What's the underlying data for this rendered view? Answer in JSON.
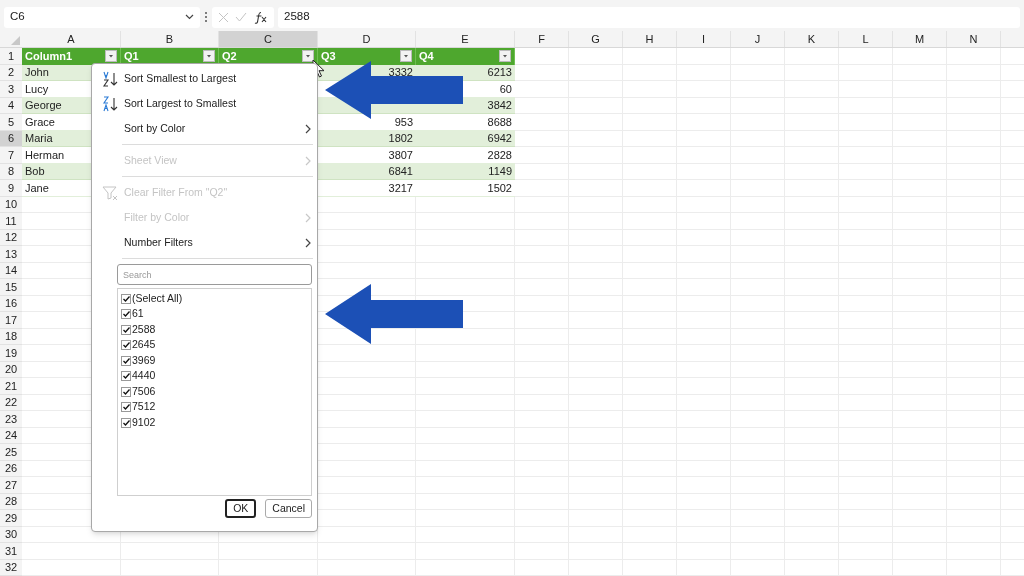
{
  "formula_bar": {
    "name_box": "C6",
    "value": "2588"
  },
  "columns": [
    {
      "label": "A",
      "selected": false
    },
    {
      "label": "B",
      "selected": false
    },
    {
      "label": "C",
      "selected": true
    },
    {
      "label": "D",
      "selected": false
    },
    {
      "label": "E",
      "selected": false
    },
    {
      "label": "F",
      "selected": false
    },
    {
      "label": "G",
      "selected": false
    },
    {
      "label": "H",
      "selected": false
    },
    {
      "label": "I",
      "selected": false
    },
    {
      "label": "J",
      "selected": false
    },
    {
      "label": "K",
      "selected": false
    },
    {
      "label": "L",
      "selected": false
    },
    {
      "label": "M",
      "selected": false
    },
    {
      "label": "N",
      "selected": false
    }
  ],
  "row_numbers": [
    {
      "label": "1",
      "selected": false
    },
    {
      "label": "2",
      "selected": false
    },
    {
      "label": "3",
      "selected": false
    },
    {
      "label": "4",
      "selected": false
    },
    {
      "label": "5",
      "selected": false
    },
    {
      "label": "6",
      "selected": true
    },
    {
      "label": "7",
      "selected": false
    },
    {
      "label": "8",
      "selected": false
    },
    {
      "label": "9",
      "selected": false
    },
    {
      "label": "10",
      "selected": false
    },
    {
      "label": "11",
      "selected": false
    },
    {
      "label": "12",
      "selected": false
    },
    {
      "label": "13",
      "selected": false
    },
    {
      "label": "14",
      "selected": false
    },
    {
      "label": "15",
      "selected": false
    },
    {
      "label": "16",
      "selected": false
    },
    {
      "label": "17",
      "selected": false
    },
    {
      "label": "18",
      "selected": false
    },
    {
      "label": "19",
      "selected": false
    },
    {
      "label": "20",
      "selected": false
    },
    {
      "label": "21",
      "selected": false
    },
    {
      "label": "22",
      "selected": false
    },
    {
      "label": "23",
      "selected": false
    },
    {
      "label": "24",
      "selected": false
    },
    {
      "label": "25",
      "selected": false
    },
    {
      "label": "26",
      "selected": false
    },
    {
      "label": "27",
      "selected": false
    },
    {
      "label": "28",
      "selected": false
    },
    {
      "label": "29",
      "selected": false
    },
    {
      "label": "30",
      "selected": false
    },
    {
      "label": "31",
      "selected": false
    },
    {
      "label": "32",
      "selected": false
    }
  ],
  "table": {
    "header": [
      "Column1",
      "Q1",
      "Q2",
      "Q3",
      "Q4"
    ],
    "rows": [
      {
        "column1": "John",
        "q3": "3332",
        "q4": "6213"
      },
      {
        "column1": "Lucy",
        "q4": "60"
      },
      {
        "column1": "George",
        "q4": "3842"
      },
      {
        "column1": "Grace",
        "q3": "953",
        "q4": "8688"
      },
      {
        "column1": "Maria",
        "q3": "1802",
        "q4": "6942"
      },
      {
        "column1": "Herman",
        "q3": "3807",
        "q4": "2828"
      },
      {
        "column1": "Bob",
        "q3": "6841",
        "q4": "1149"
      },
      {
        "column1": "Jane",
        "q3": "3217",
        "q4": "1502"
      }
    ]
  },
  "filter_menu": {
    "items": [
      {
        "kind": "sort-asc",
        "label": "Sort Smallest to Largest",
        "disabled": false
      },
      {
        "kind": "sort-desc",
        "label": "Sort Largest to Smallest",
        "disabled": false
      },
      {
        "kind": "submenu",
        "label": "Sort by Color",
        "disabled": false
      },
      {
        "kind": "separator"
      },
      {
        "kind": "submenu",
        "label": "Sheet View",
        "disabled": true
      },
      {
        "kind": "separator"
      },
      {
        "kind": "clear-filter",
        "label": "Clear Filter From \"Q2\"",
        "disabled": true
      },
      {
        "kind": "submenu",
        "label": "Filter by Color",
        "disabled": true
      },
      {
        "kind": "submenu",
        "label": "Number Filters",
        "disabled": false
      },
      {
        "kind": "separator"
      }
    ],
    "search": {
      "placeholder": "Search"
    },
    "values": [
      {
        "label": "(Select All)",
        "checked": true
      },
      {
        "label": "61",
        "checked": true
      },
      {
        "label": "2588",
        "checked": true
      },
      {
        "label": "2645",
        "checked": true
      },
      {
        "label": "3969",
        "checked": true
      },
      {
        "label": "4440",
        "checked": true
      },
      {
        "label": "7506",
        "checked": true
      },
      {
        "label": "7512",
        "checked": true
      },
      {
        "label": "9102",
        "checked": true
      }
    ],
    "buttons": [
      {
        "label": "OK",
        "default": true
      },
      {
        "label": "Cancel",
        "default": false
      }
    ]
  }
}
